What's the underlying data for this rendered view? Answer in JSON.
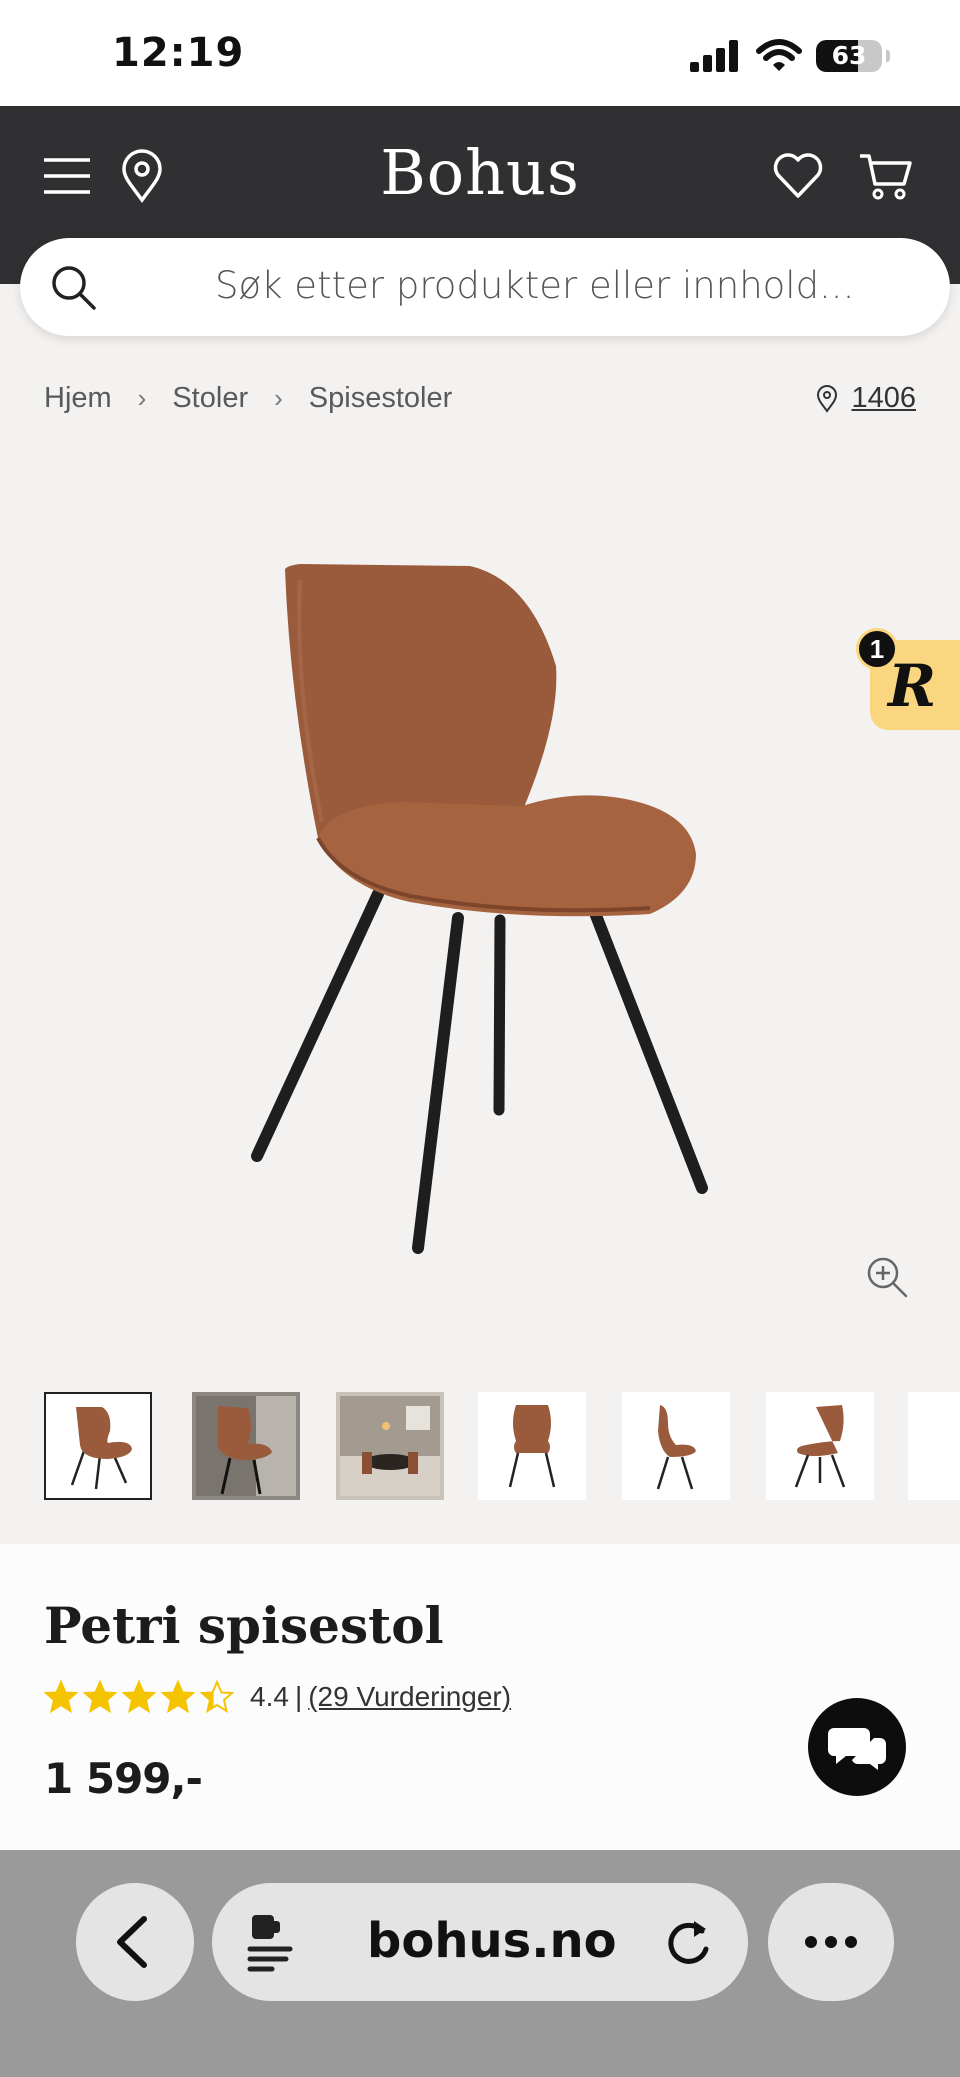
{
  "status_bar": {
    "time": "12:19",
    "battery": "63",
    "battery_level": 0.63
  },
  "header": {
    "logo": "Bohus"
  },
  "search": {
    "placeholder": "Søk etter produkter eller innhold..."
  },
  "breadcrumb": {
    "items": [
      "Hjem",
      "Stoler",
      "Spisestoler"
    ],
    "store_number": "1406"
  },
  "badge": {
    "count": "1",
    "letter": "R"
  },
  "product": {
    "title": "Petri spisestol",
    "rating": "4.4",
    "rating_value": 4.4,
    "rating_max": 5,
    "reviews": "(29 Vurderinger)",
    "price": "1 599,-"
  },
  "thumbnails": {
    "count": 7,
    "selected_index": 0
  },
  "browser": {
    "url": "bohus.no"
  },
  "colors": {
    "header_bg": "#303032",
    "page_bg": "#f4f2f0",
    "star": "#f5c400",
    "badge": "#fbd680",
    "chair_leather": "#9a5a3c"
  }
}
